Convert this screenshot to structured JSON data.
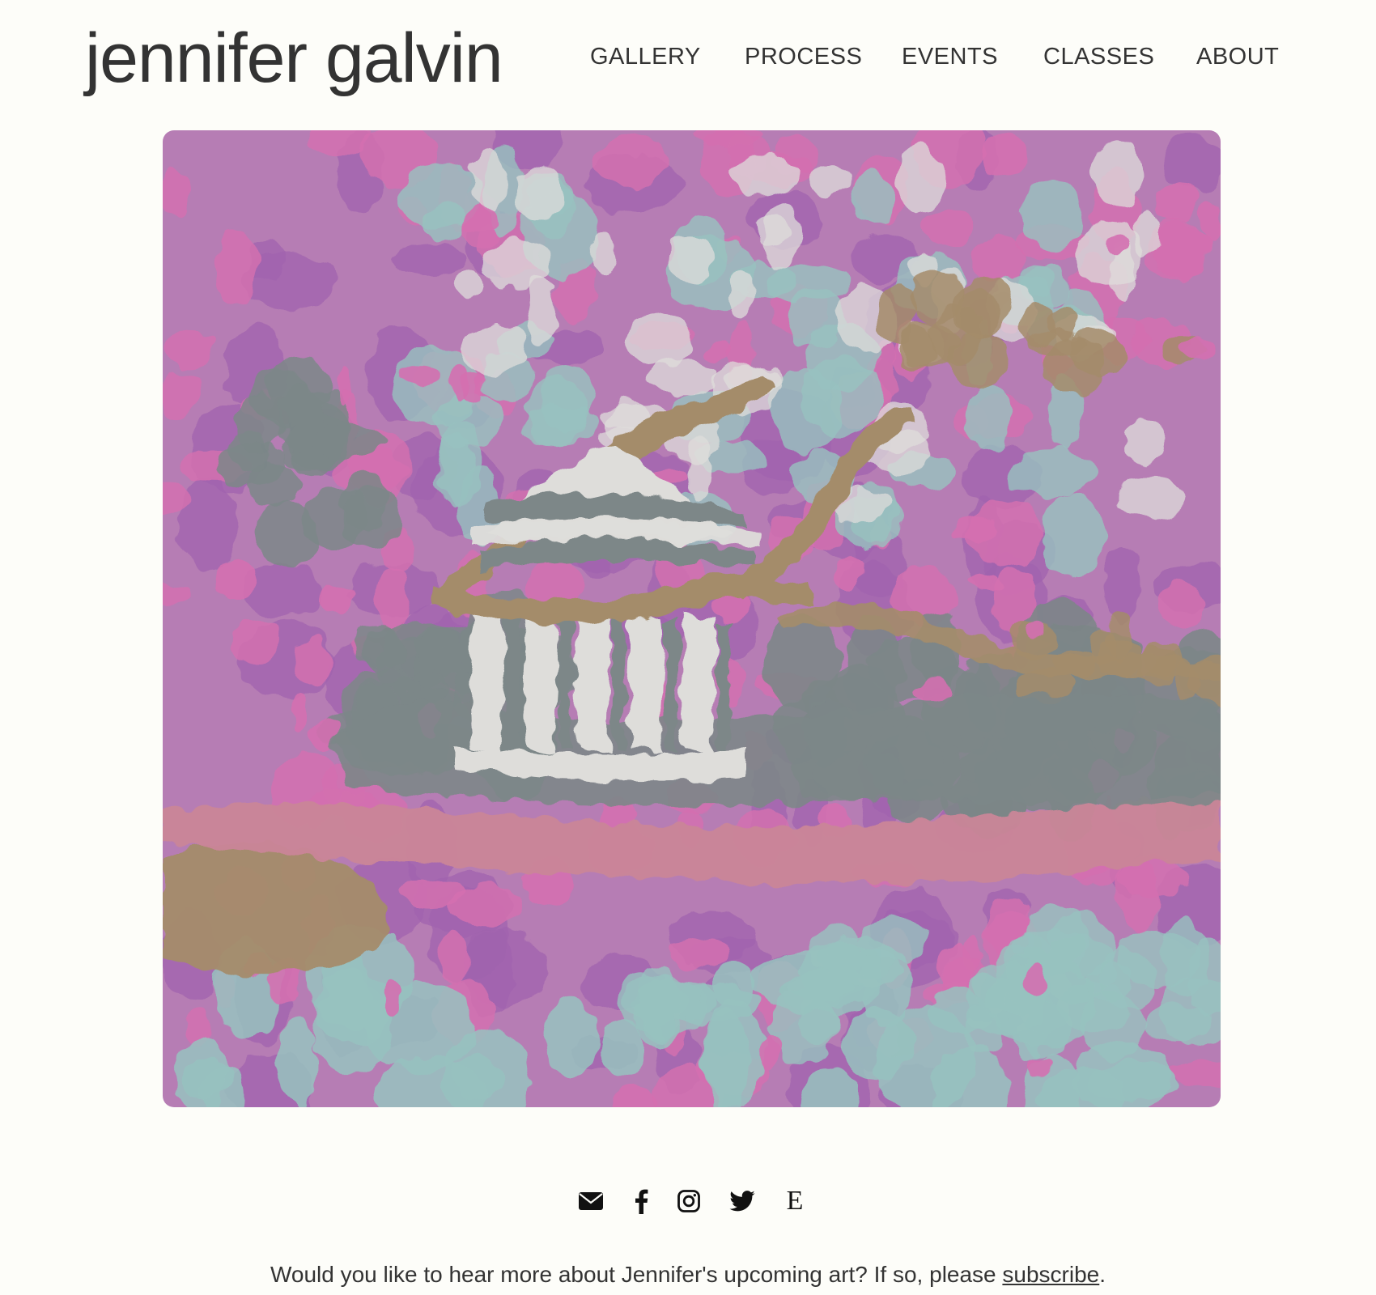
{
  "site": {
    "title": "jennifer galvin"
  },
  "nav": {
    "items": [
      {
        "label": "GALLERY"
      },
      {
        "label": "PROCESS"
      },
      {
        "label": "EVENTS"
      },
      {
        "label": "CLASSES"
      },
      {
        "label": "ABOUT"
      }
    ]
  },
  "artwork": {
    "palette": {
      "base": "#c98ac6",
      "magenta": "#e97bc2",
      "violet": "#b06ec0",
      "gray": "#8a9596",
      "aqua": "#a7d6d2",
      "white": "#f4f3f0",
      "tan": "#b59a75",
      "salmon": "#de94a8"
    }
  },
  "social": {
    "icons": [
      {
        "name": "envelope-icon"
      },
      {
        "name": "facebook-icon"
      },
      {
        "name": "instagram-icon"
      },
      {
        "name": "twitter-icon"
      },
      {
        "name": "etsy-icon",
        "glyph": "E"
      }
    ]
  },
  "footer": {
    "text_before": "Would you like to hear more about Jennifer's upcoming art? If so, please ",
    "link_label": "subscribe",
    "text_after": "."
  }
}
